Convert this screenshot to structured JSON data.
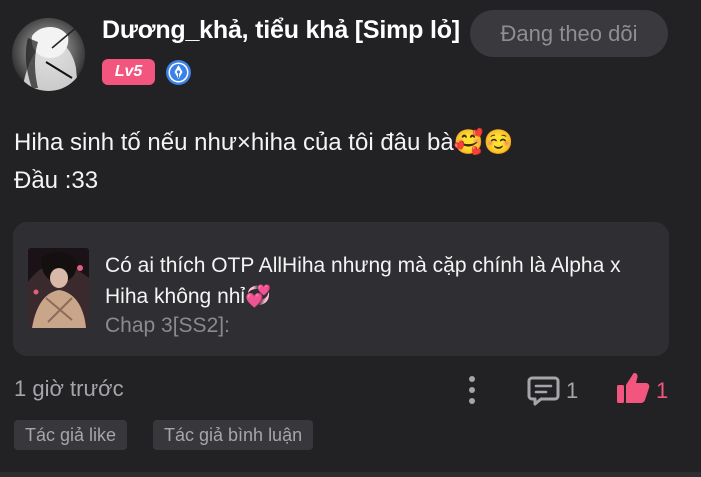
{
  "comment": {
    "author": {
      "name": "Dương_khả, tiểu khả [Simp lỏ]",
      "level": "Lv5",
      "badge_icon": "pen-nib-icon"
    },
    "follow_button_label": "Đang theo dõi",
    "text": "Hiha sinh tố nếu như×hiha của tôi đâu bà🥰☺️\nĐầu :33",
    "quoted": {
      "title": "Có ai thích OTP AllHiha nhưng mà cặp chính là Alpha x Hiha không nhỉ💞",
      "chapter": "Chap 3[SS2]:"
    },
    "timestamp": "1 giờ trước",
    "reply_count": "1",
    "like_count": "1",
    "tags": [
      "Tác giả like",
      "Tác giả bình luận"
    ]
  },
  "colors": {
    "background": "#222225",
    "card": "#2f2f33",
    "accent": "#f2557e",
    "muted": "#a5a5aa",
    "badge_blue": "#3b82e8"
  }
}
